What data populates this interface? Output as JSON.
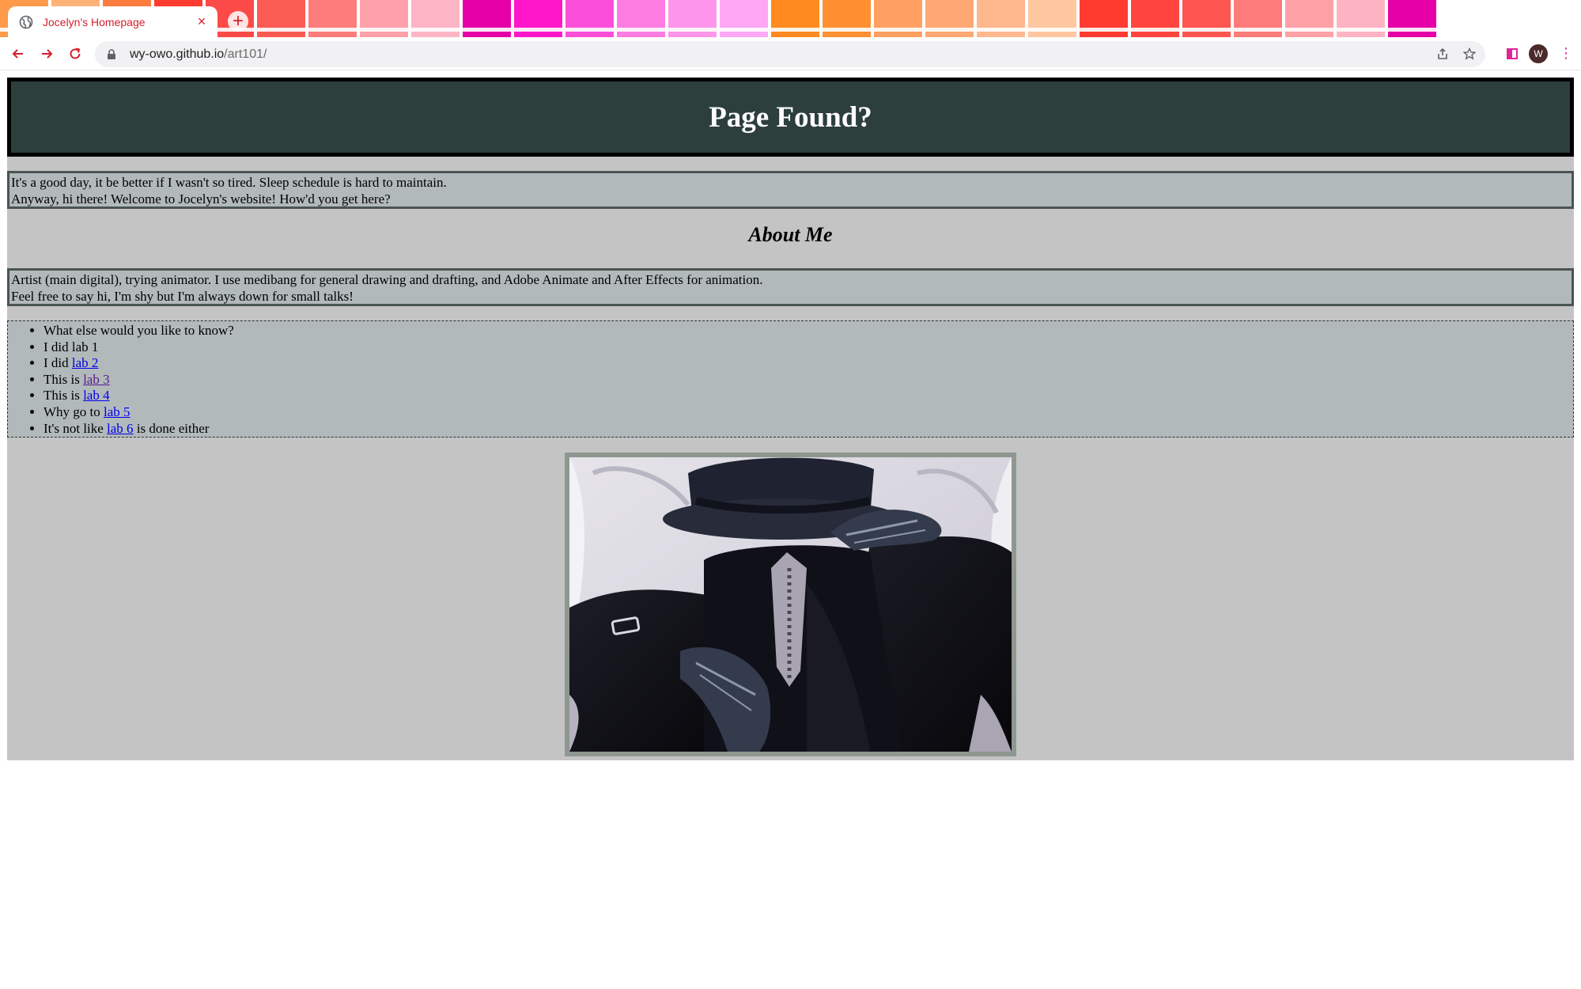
{
  "browser": {
    "tab_title": "Jocelyn's Homepage",
    "tab_close": "×",
    "new_tab": "+",
    "tab_menu": "⌄",
    "url_host": "wy-owo.github.io",
    "url_path": "/art101/",
    "avatar_letter": "W",
    "theme_swatches": [
      "#fe9a4a",
      "#fdb278",
      "#fd7c3f",
      "#ff3b30",
      "#fb4a47",
      "#fa5b52",
      "#fd7c7c",
      "#fea1aa",
      "#fdb5c5",
      "#e600a8",
      "#ff17c9",
      "#fc4fd9",
      "#fd7ce2",
      "#fd96ea",
      "#fea7f5",
      "#ff8a1f",
      "#ff8f30",
      "#ffa062",
      "#ffa874",
      "#ffb88e",
      "#ffc7a0",
      "#ff3b30",
      "#ff453d",
      "#fe5550",
      "#fe7b7b",
      "#fea1a7",
      "#feb3c3",
      "#e600a8"
    ]
  },
  "page": {
    "heading": "Page Found?",
    "intro": [
      "It's a good day, it be better if I wasn't so tired. Sleep schedule is hard to maintain.",
      "Anyway, hi there! Welcome to Jocelyn's website! How'd you get here?"
    ],
    "about_heading": "About Me",
    "about": [
      "Artist (main digital), trying animator. I use medibang for general drawing and drafting, and Adobe Animate and After Effects for animation.",
      "Feel free to say hi, I'm shy but I'm always down for small talks!"
    ],
    "list": [
      {
        "before": "What else would you like to know?",
        "link": "",
        "after": ""
      },
      {
        "before": "I did lab 1",
        "link": "",
        "after": ""
      },
      {
        "before": "I did ",
        "link": "lab 2",
        "after": ""
      },
      {
        "before": "This is ",
        "link": "lab 3",
        "after": ""
      },
      {
        "before": "This is ",
        "link": "lab 4",
        "after": ""
      },
      {
        "before": "Why go to ",
        "link": "lab 5",
        "after": ""
      },
      {
        "before": "It's not like ",
        "link": "lab 6",
        "after": " is done either"
      }
    ]
  }
}
